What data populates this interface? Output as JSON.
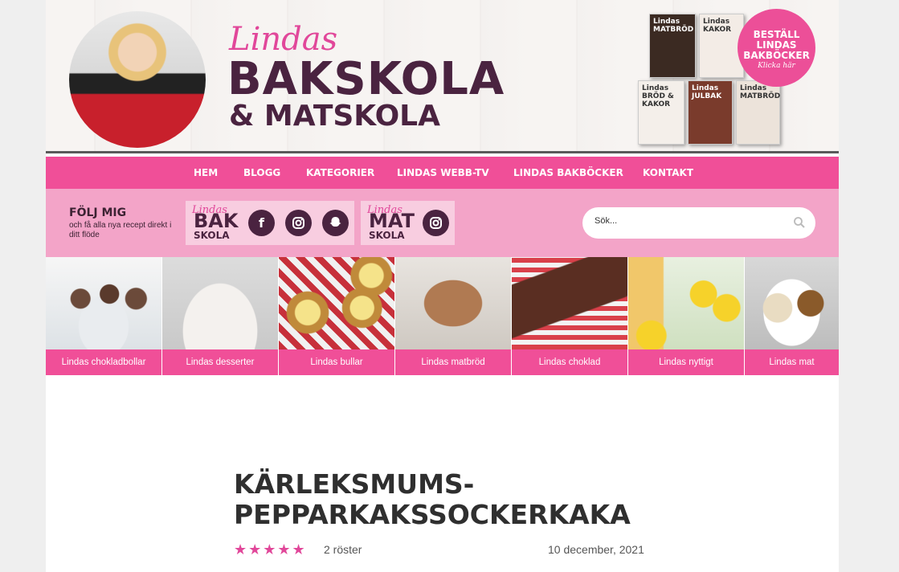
{
  "header": {
    "logo_lindas": "Lindas",
    "logo_line1": "BAKSKOLA",
    "logo_line2": "& MATSKOLA",
    "books": [
      {
        "title": "Lindas MATBRÖD"
      },
      {
        "title": "Lindas KAKOR"
      },
      {
        "title": "Lindas BRÖD & KAKOR"
      },
      {
        "title": "Lindas JULBAK"
      },
      {
        "title": "Lindas MATBRÖD"
      }
    ],
    "order_badge": {
      "line1": "BESTÄLL",
      "line2": "LINDAS",
      "line3": "BAKBÖCKER",
      "sub": "Klicka här"
    }
  },
  "nav": {
    "items": [
      "HEM",
      "BLOGG",
      "KATEGORIER",
      "LINDAS WEBB-TV",
      "LINDAS BAKBÖCKER",
      "KONTAKT"
    ]
  },
  "follow": {
    "title": "FÖLJ MIG",
    "subtitle": "och få alla nya recept direkt i ditt flöde",
    "bakskola": {
      "lindas": "Lindas",
      "word": "BAK",
      "skola": "SKOLA"
    },
    "matskola": {
      "lindas": "Lindas",
      "word": "MAT",
      "skola": "SKOLA"
    },
    "icons": [
      "facebook-icon",
      "instagram-icon",
      "snapchat-icon",
      "instagram-icon"
    ]
  },
  "search": {
    "placeholder": "Sök..."
  },
  "categories": [
    {
      "label": "Lindas chokladbollar"
    },
    {
      "label": "Lindas desserter"
    },
    {
      "label": "Lindas bullar"
    },
    {
      "label": "Lindas matbröd"
    },
    {
      "label": "Lindas choklad"
    },
    {
      "label": "Lindas nyttigt"
    },
    {
      "label": "Lindas mat"
    }
  ],
  "article": {
    "title": "KÄRLEKSMUMS-PEPPARKAKSSOCKERKAKA",
    "rating": 5,
    "stars": "★★★★★",
    "votes": "2 röster",
    "date": "10 december, 2021"
  },
  "colors": {
    "accent": "#f04f98",
    "dark": "#4a2340",
    "follow_bg": "#f3a4c8"
  }
}
